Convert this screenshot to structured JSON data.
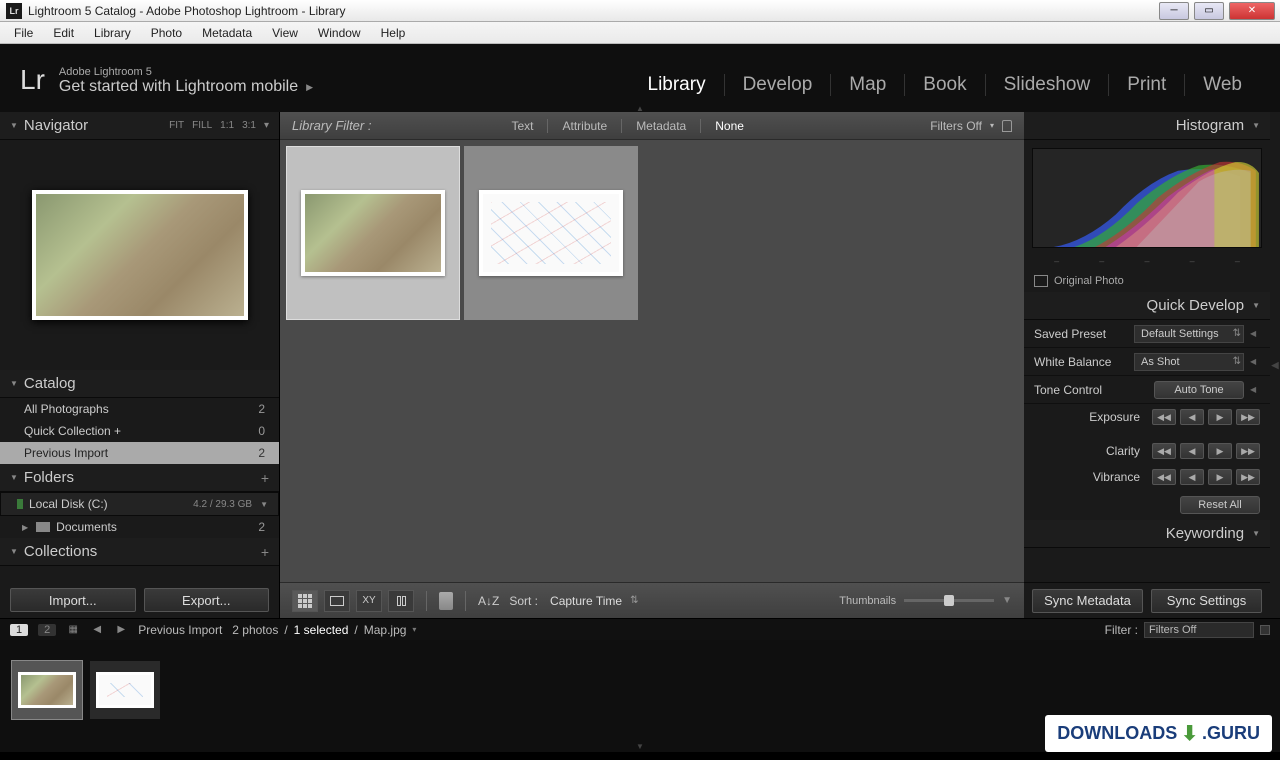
{
  "window": {
    "title": "Lightroom 5 Catalog - Adobe Photoshop Lightroom - Library",
    "app_icon": "Lr"
  },
  "menubar": [
    "File",
    "Edit",
    "Library",
    "Photo",
    "Metadata",
    "View",
    "Window",
    "Help"
  ],
  "header": {
    "logo": "Lr",
    "brand": "Adobe Lightroom 5",
    "tagline": "Get started with Lightroom mobile",
    "modules": [
      "Library",
      "Develop",
      "Map",
      "Book",
      "Slideshow",
      "Print",
      "Web"
    ],
    "active_module": "Library"
  },
  "left": {
    "navigator": {
      "title": "Navigator",
      "zoom": [
        "FIT",
        "FILL",
        "1:1",
        "3:1"
      ]
    },
    "catalog": {
      "title": "Catalog",
      "items": [
        {
          "label": "All Photographs",
          "count": "2"
        },
        {
          "label": "Quick Collection  +",
          "count": "0"
        },
        {
          "label": "Previous Import",
          "count": "2"
        }
      ],
      "selected": 2
    },
    "folders": {
      "title": "Folders",
      "disk": {
        "name": "Local Disk (C:)",
        "capacity": "4.2 / 29.3 GB"
      },
      "items": [
        {
          "label": "Documents",
          "count": "2"
        }
      ]
    },
    "collections": {
      "title": "Collections"
    },
    "import_label": "Import...",
    "export_label": "Export..."
  },
  "center": {
    "filter_label": "Library Filter :",
    "filter_tabs": [
      "Text",
      "Attribute",
      "Metadata",
      "None"
    ],
    "filter_active": "None",
    "filters_off": "Filters Off",
    "sort_label": "Sort :",
    "sort_value": "Capture Time",
    "thumbnails_label": "Thumbnails"
  },
  "right": {
    "histogram": {
      "title": "Histogram",
      "original_photo": "Original Photo"
    },
    "quickdev": {
      "title": "Quick Develop",
      "preset_label": "Saved Preset",
      "preset_value": "Default Settings",
      "wb_label": "White Balance",
      "wb_value": "As Shot",
      "tone_label": "Tone Control",
      "auto_tone": "Auto Tone",
      "exposure_label": "Exposure",
      "clarity_label": "Clarity",
      "vibrance_label": "Vibrance",
      "reset_label": "Reset All"
    },
    "keywording": {
      "title": "Keywording"
    },
    "sync_metadata": "Sync Metadata",
    "sync_settings": "Sync Settings"
  },
  "statusbar": {
    "pages": [
      "1",
      "2"
    ],
    "breadcrumb": "Previous Import",
    "photo_count": "2 photos",
    "selected": "1 selected",
    "filename": "Map.jpg",
    "filter_label": "Filter :",
    "filter_value": "Filters Off"
  },
  "watermark": {
    "text1": "DOWNLOADS",
    "text2": ".GURU"
  }
}
